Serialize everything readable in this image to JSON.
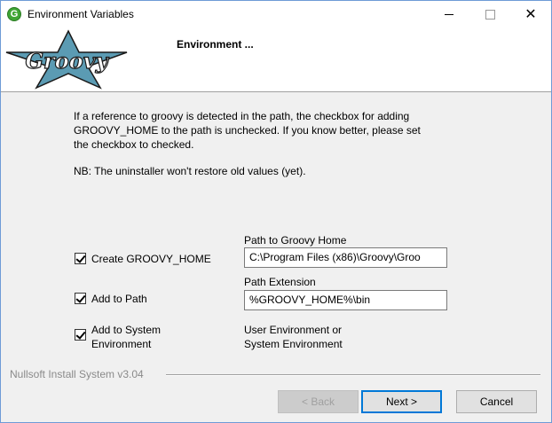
{
  "window": {
    "title": "Environment Variables",
    "icon_letter": "G"
  },
  "header": {
    "title": "Environment ...",
    "logo_text": "Groovy"
  },
  "intro": {
    "paragraph1": "If a reference to groovy is detected in the path, the checkbox for adding GROOVY_HOME to the path is unchecked. If you know better, please set the checkbox to checked.",
    "paragraph2": "NB: The uninstaller won't restore old values (yet)."
  },
  "options": [
    {
      "label": "Create GROOVY_HOME",
      "checked": true
    },
    {
      "label": "Add to Path",
      "checked": true
    },
    {
      "label_line1": "Add to System",
      "label_line2": "Environment",
      "checked": true
    }
  ],
  "fields": {
    "groovy_home_label": "Path to Groovy Home",
    "groovy_home_value": "C:\\Program Files (x86)\\Groovy\\Groo",
    "path_ext_label": "Path Extension",
    "path_ext_value": "%GROOVY_HOME%\\bin",
    "env_label_line1": "User Environment or",
    "env_label_line2": "System Environment"
  },
  "footer": {
    "brand": "Nullsoft Install System v3.04",
    "back_label": "< Back",
    "next_label": "Next >",
    "cancel_label": "Cancel"
  },
  "colors": {
    "logo_star": "#5b9bb3",
    "logo_text": "#ffffff",
    "accent": "#0078d7"
  }
}
